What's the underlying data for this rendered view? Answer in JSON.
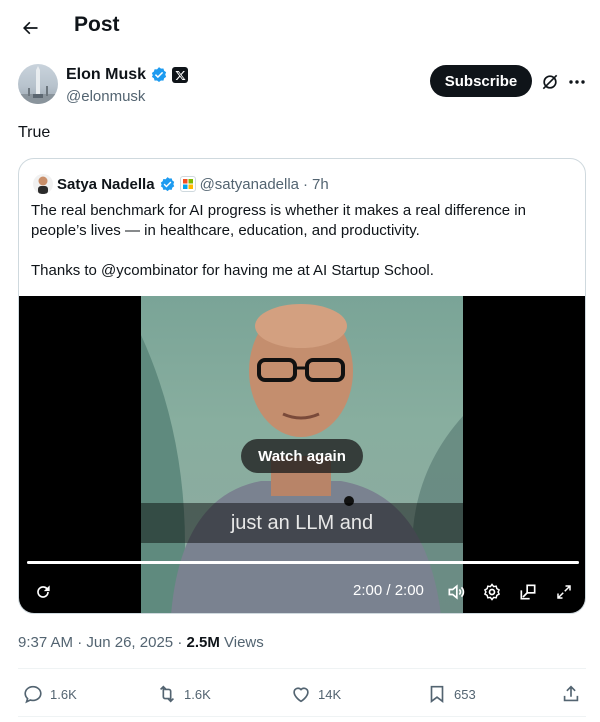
{
  "header": {
    "title": "Post"
  },
  "author": {
    "name": "Elon Musk",
    "handle": "@elonmusk",
    "subscribe_label": "Subscribe"
  },
  "post": {
    "text": "True"
  },
  "quote": {
    "name": "Satya Nadella",
    "handle": "@satyanadella",
    "time": "7h",
    "paragraphs": [
      "The real benchmark for AI progress is whether it makes a real difference in people’s lives — in healthcare, education, and productivity.",
      "Thanks to @ycombinator for having me at AI Startup School."
    ],
    "video": {
      "watch_again_label": "Watch again",
      "caption": "just an LLM and",
      "time": "2:00 / 2:00",
      "progress": 1.0
    }
  },
  "meta": {
    "time": "9:37 AM",
    "date": "Jun 26, 2025",
    "views_count": "2.5M",
    "views_label": "Views"
  },
  "actions": {
    "replies": "1.6K",
    "reposts": "1.6K",
    "likes": "14K",
    "bookmarks": "653"
  },
  "colors": {
    "verified": "#1d9bf0",
    "text": "#0f1419",
    "secondary": "#536471",
    "border": "#cfd9de"
  },
  "icons": [
    "back-arrow-icon",
    "verified-badge-icon",
    "x-affiliate-icon",
    "grok-icon",
    "more-icon",
    "replay-icon",
    "volume-icon",
    "settings-icon",
    "dock-icon",
    "fullscreen-icon",
    "reply-icon",
    "repost-icon",
    "like-icon",
    "bookmark-icon",
    "share-icon"
  ]
}
